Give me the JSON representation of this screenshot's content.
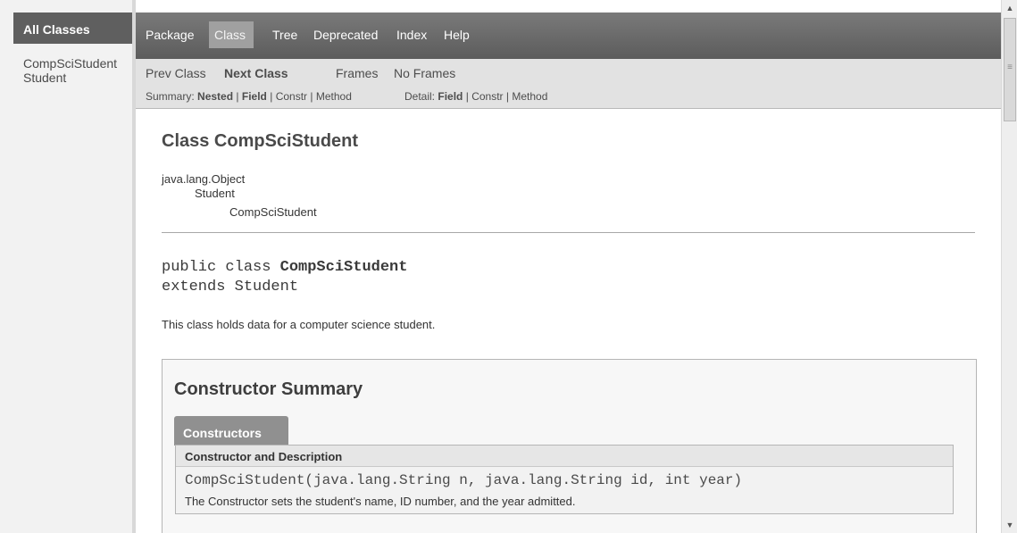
{
  "left_frame": {
    "header": "All Classes",
    "classes": [
      "CompSciStudent",
      "Student"
    ]
  },
  "topnav": {
    "items": [
      "Package",
      "Class",
      "Tree",
      "Deprecated",
      "Index",
      "Help"
    ],
    "active": "Class"
  },
  "subnav": {
    "prev_class": "Prev Class",
    "next_class": "Next Class",
    "frames": "Frames",
    "no_frames": "No Frames",
    "summary_label": "Summary:",
    "summary_nested": "Nested",
    "summary_field": "Field",
    "summary_constr": "Constr",
    "summary_method": "Method",
    "detail_label": "Detail:",
    "detail_field": "Field",
    "detail_constr": "Constr",
    "detail_method": "Method",
    "separator": "|"
  },
  "content": {
    "class_title": "Class CompSciStudent",
    "inheritance": [
      "java.lang.Object",
      "Student",
      "CompSciStudent"
    ],
    "declaration_prefix": "public class ",
    "declaration_name": "CompSciStudent",
    "extends_keyword": "extends ",
    "extends_name": "Student",
    "description": "This class holds data for a computer science student."
  },
  "constructor_summary": {
    "heading": "Constructor Summary",
    "tab_label": "Constructors",
    "column_header": "Constructor and Description",
    "signature_name": "CompSciStudent",
    "signature_params": "(java.lang.String n, java.lang.String id, int year)",
    "description": "The Constructor sets the student's name, ID number, and the year admitted."
  },
  "scrollbar": {
    "up_icon": "▲",
    "grip_icon": "≡",
    "down_icon": "▼"
  }
}
